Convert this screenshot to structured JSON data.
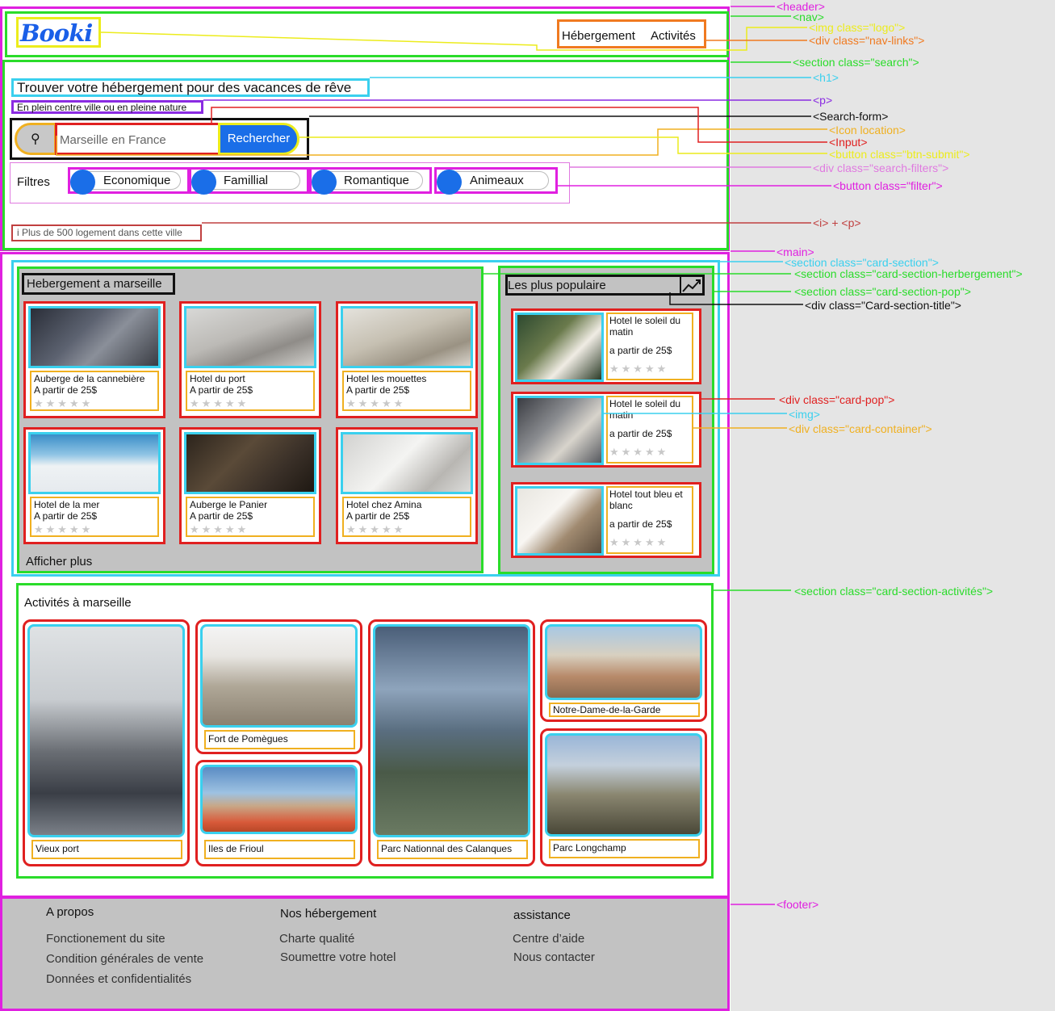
{
  "brand": {
    "logo_text": "Booki",
    "primary_color": "#1a6ee8"
  },
  "nav": {
    "links": [
      "Hébergement",
      "Activités"
    ]
  },
  "search": {
    "title": "Trouver votre hébergement pour des vacances de rêve",
    "subtitle": "En plein centre ville ou en pleine nature",
    "input_value": "Marseille en France",
    "submit_label": "Rechercher",
    "location_icon": "location-pin-icon",
    "filters_label": "Filtres",
    "filters": [
      "Economique",
      "Famillial",
      "Romantique",
      "Animeaux"
    ],
    "info_text": "i Plus de 500 logement dans cette ville"
  },
  "hebergement": {
    "title": "Hebergement a marseille",
    "cards": [
      {
        "name": "Auberge de la cannebière",
        "price": "A partir de 25$"
      },
      {
        "name": "Hotel du port",
        "price": "A partir de 25$"
      },
      {
        "name": "Hotel les mouettes",
        "price": "A partir de 25$"
      },
      {
        "name": "Hotel de la mer",
        "price": "A partir de 25$"
      },
      {
        "name": "Auberge le Panier",
        "price": "A partir de 25$"
      },
      {
        "name": "Hotel chez Amina",
        "price": "A partir de 25$"
      }
    ],
    "more_label": "Afficher plus",
    "stars": "★★★★★"
  },
  "popular": {
    "title": "Les plus populaire",
    "trend_icon": "trending-up-icon",
    "cards": [
      {
        "name": "Hotel le soleil du matin",
        "price": "a partir de 25$"
      },
      {
        "name": "Hotel le soleil du matin",
        "price": "a partir de 25$"
      },
      {
        "name": "Hotel tout bleu et blanc",
        "price": "a partir de 25$"
      }
    ]
  },
  "activities": {
    "title": "Activités à marseille",
    "items": [
      "Vieux port",
      "Fort de Pomègues",
      "Iles de Frioul",
      "Parc Nationnal des Calanques",
      "Notre-Dame-de-la-Garde",
      "Parc Longchamp"
    ]
  },
  "footer": {
    "columns": [
      {
        "title": "A propos",
        "links": [
          "Fonctionement du site",
          "Condition générales de vente",
          "Données et confidentialités"
        ]
      },
      {
        "title": "Nos hébergement",
        "links": [
          "Charte qualité",
          "Soumettre votre hotel"
        ]
      },
      {
        "title": "assistance",
        "links": [
          "Centre d’aide",
          "Nous contacter"
        ]
      }
    ]
  },
  "annotations": {
    "header": "<header>",
    "nav": "<nav>",
    "logo": "<img class=\"logo\">",
    "nav_links": "<div class=\"nav-links\">",
    "section_search": "<section class=\"search\">",
    "h1": "<h1>",
    "p": "<p>",
    "search_form": "<Search-form>",
    "icon_location": "<Icon location>",
    "input": "<Input>",
    "button_submit": "<button class=\"btn-submit\">",
    "search_filters": "<div class=\"search-filters\">",
    "button_filter": "<button class=\"filter\">",
    "i_p": "<i> + <p>",
    "main": "<main>",
    "card_section": "<section class=\"card-section\">",
    "card_section_herbergement": "<section class=\"card-section-herbergement\">",
    "card_section_pop": "<section class=\"card-section-pop\">",
    "card_section_title": "<div class=\"Card-section-title\">",
    "card_pop": "<div class=\"card-pop\">",
    "img": "<img>",
    "card_container": "<div class=\"card-container\">",
    "card_section_activites": "<section class=\"card-section-activités\">",
    "footer": "<footer>"
  }
}
